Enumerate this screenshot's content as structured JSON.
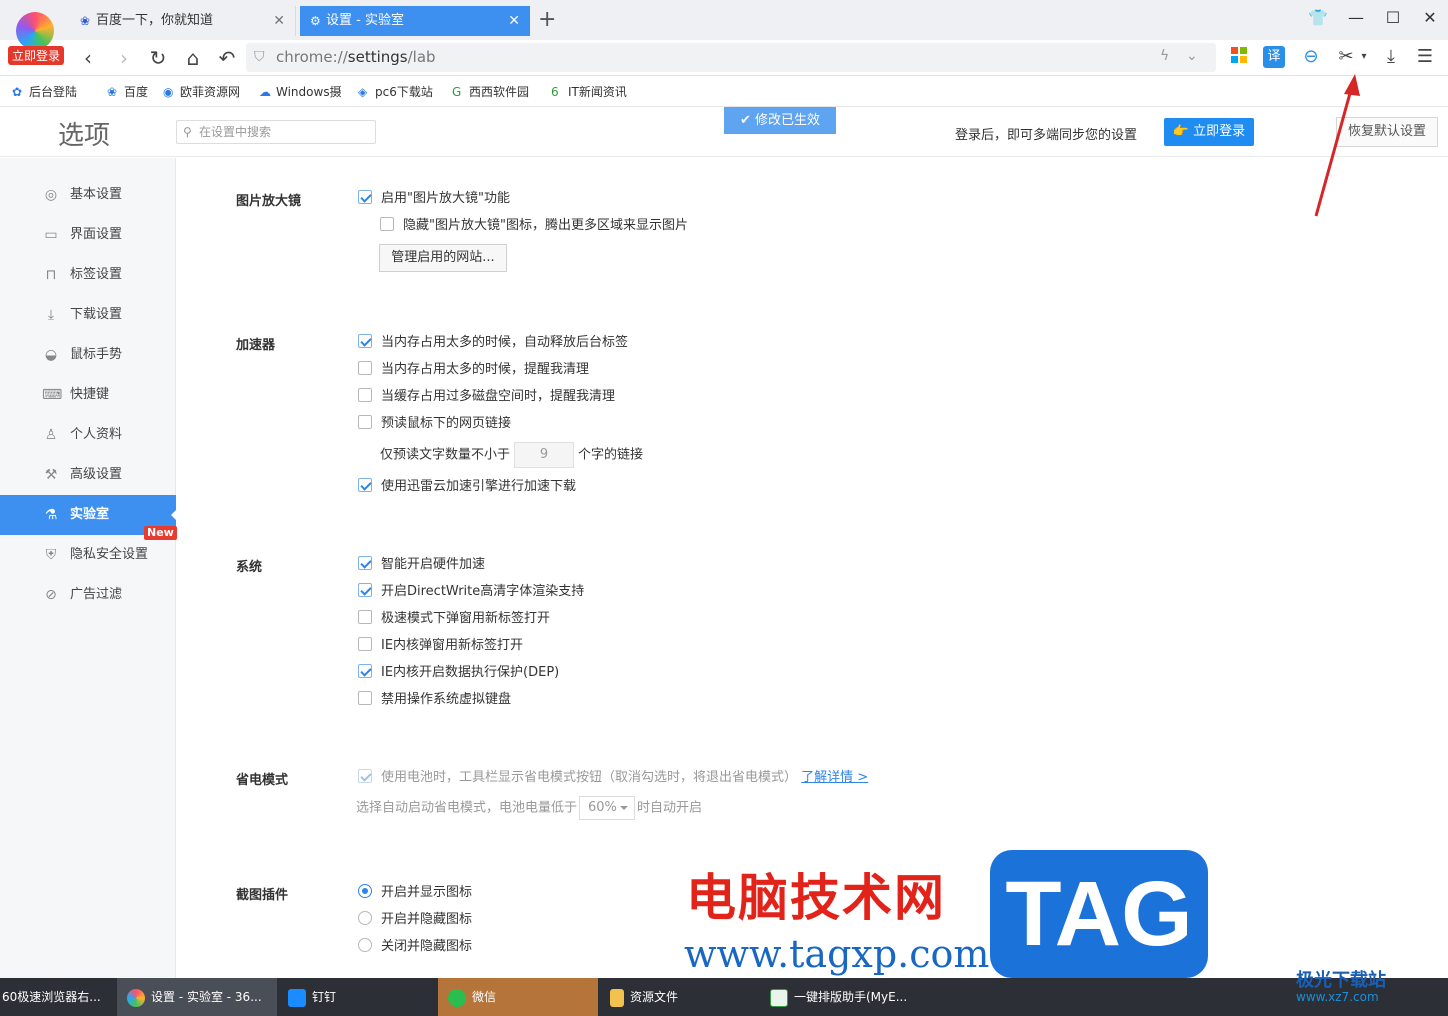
{
  "browser": {
    "logo_badge": "立即登录",
    "tabs": [
      {
        "title": "百度一下，你就知道",
        "active": false
      },
      {
        "title": "设置 - 实验室",
        "active": true
      }
    ],
    "address": {
      "scheme": "chrome://",
      "host": "settings",
      "path": "/lab"
    },
    "bookmarks": [
      "后台登陆",
      "百度",
      "欧菲资源网",
      "Windows摄",
      "pc6下载站",
      "西西软件园",
      "IT新闻资讯"
    ]
  },
  "header": {
    "title": "选项",
    "search_placeholder": "在设置中搜索",
    "saved_notice": "修改已生效",
    "login_hint": "登录后，即可多端同步您的设置",
    "login_button": "立即登录",
    "restore_button": "恢复默认设置"
  },
  "sidebar": {
    "items": [
      {
        "label": "基本设置",
        "icon": "gear-icon"
      },
      {
        "label": "界面设置",
        "icon": "window-icon"
      },
      {
        "label": "标签设置",
        "icon": "tab-icon"
      },
      {
        "label": "下载设置",
        "icon": "download-icon"
      },
      {
        "label": "鼠标手势",
        "icon": "mouse-icon"
      },
      {
        "label": "快捷键",
        "icon": "keyboard-icon"
      },
      {
        "label": "个人资料",
        "icon": "user-icon"
      },
      {
        "label": "高级设置",
        "icon": "wrench-icon"
      },
      {
        "label": "实验室",
        "icon": "flask-icon",
        "active": true
      },
      {
        "label": "隐私安全设置",
        "icon": "shield-icon"
      },
      {
        "label": "广告过滤",
        "icon": "block-icon"
      }
    ],
    "new_badge": "New"
  },
  "sections": {
    "magnifier": {
      "title": "图片放大镜",
      "enable": {
        "label": "启用\"图片放大镜\"功能",
        "checked": true
      },
      "hide_icon": {
        "label": "隐藏\"图片放大镜\"图标，腾出更多区域来显示图片",
        "checked": false
      },
      "manage_button": "管理启用的网站..."
    },
    "accelerator": {
      "title": "加速器",
      "options": [
        {
          "label": "当内存占用太多的时候，自动释放后台标签",
          "checked": true
        },
        {
          "label": "当内存占用太多的时候，提醒我清理",
          "checked": false
        },
        {
          "label": "当缓存占用过多磁盘空间时，提醒我清理",
          "checked": false
        },
        {
          "label": "预读鼠标下的网页链接",
          "checked": false
        }
      ],
      "preread_prefix": "仅预读文字数量不小于",
      "preread_value": "9",
      "preread_suffix": "个字的链接",
      "thunder": {
        "label": "使用迅雷云加速引擎进行加速下载",
        "checked": true
      }
    },
    "system": {
      "title": "系统",
      "options": [
        {
          "label": "智能开启硬件加速",
          "checked": true
        },
        {
          "label": "开启DirectWrite高清字体渲染支持",
          "checked": true
        },
        {
          "label": "极速模式下弹窗用新标签打开",
          "checked": false
        },
        {
          "label": "IE内核弹窗用新标签打开",
          "checked": false
        },
        {
          "label": "IE内核开启数据执行保护(DEP)",
          "checked": true
        },
        {
          "label": "禁用操作系统虚拟键盘",
          "checked": false
        }
      ]
    },
    "power": {
      "title": "省电模式",
      "option": {
        "label": "使用电池时，工具栏显示省电模式按钮（取消勾选时，将退出省电模式）",
        "checked": true
      },
      "link": "了解详情 >",
      "auto_prefix": "选择自动启动省电模式，电池电量低于",
      "auto_value": "60%",
      "auto_suffix": "时自动开启"
    },
    "screenshot": {
      "title": "截图插件",
      "options": [
        {
          "label": "开启并显示图标",
          "checked": true
        },
        {
          "label": "开启并隐藏图标",
          "checked": false
        },
        {
          "label": "关闭并隐藏图标",
          "checked": false
        }
      ]
    }
  },
  "watermark": {
    "cn": "电脑技术网",
    "url": "www.tagxp.com",
    "tag": "TAG",
    "site2": "极光下载站",
    "site2_url": "www.xz7.com"
  },
  "taskbar": [
    {
      "label": "60极速浏览器右..."
    },
    {
      "label": "设置 - 实验室 - 36..."
    },
    {
      "label": "钉钉"
    },
    {
      "label": "微信"
    },
    {
      "label": "资源文件"
    },
    {
      "label": "一键排版助手(MyE..."
    }
  ]
}
